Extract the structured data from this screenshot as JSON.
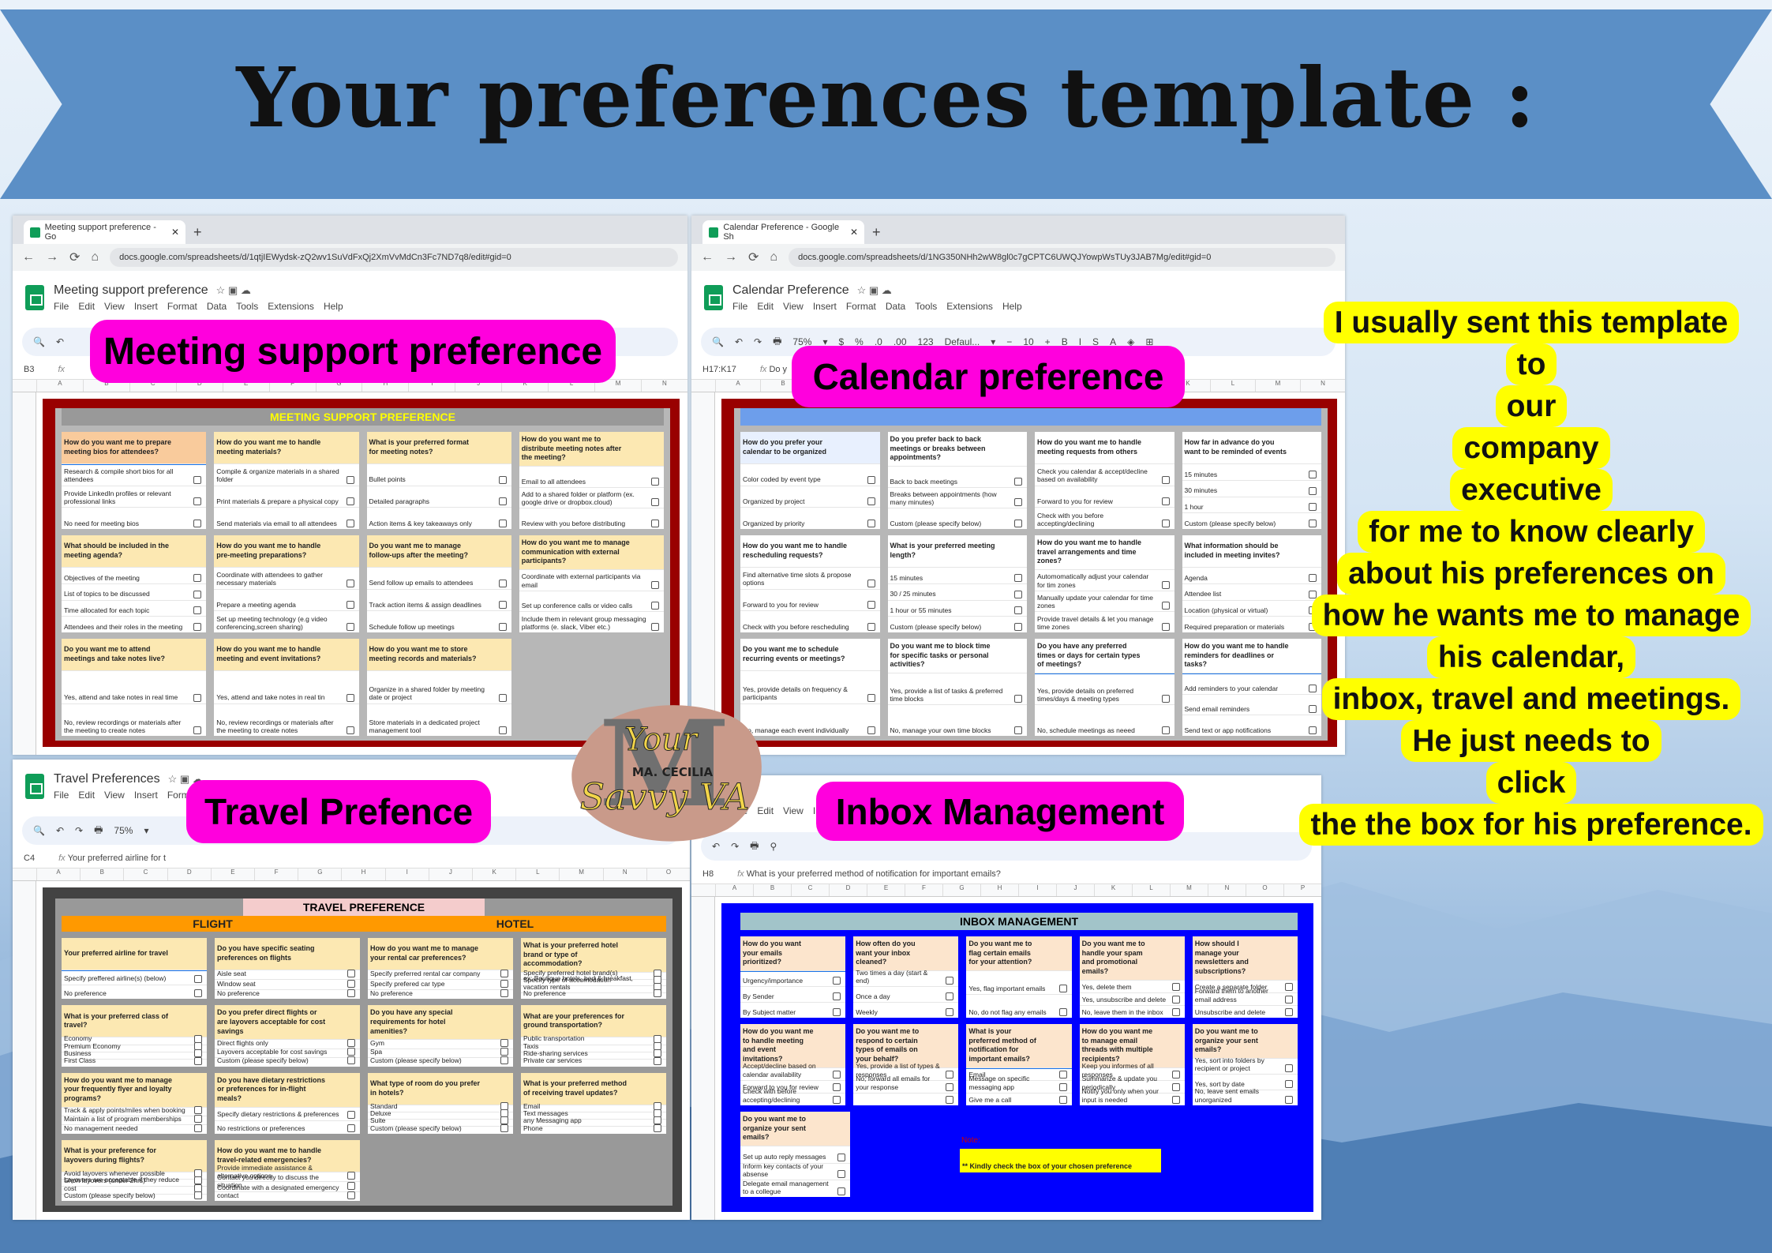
{
  "banner": {
    "title": "Your preferences template :"
  },
  "labels": {
    "meeting": "Meeting support preference",
    "calendar": "Calendar preference",
    "travel": "Travel Prefence",
    "inbox": "Inbox Management"
  },
  "logo": {
    "text_top": "Your",
    "text_mid": "MA. CECILIA",
    "text_bottom": "Savvy VA"
  },
  "message": {
    "lines": [
      "I usually sent this template",
      "to",
      "our",
      "company",
      "executive",
      "for me to know clearly",
      "about his preferences on",
      "how he wants me to manage",
      "his calendar,",
      "inbox, travel and meetings.",
      "He just needs to",
      "click",
      "the the box for his preference."
    ]
  },
  "sheets": {
    "meeting": {
      "tab": "Meeting support preference - Go",
      "url": "docs.google.com/spreadsheets/d/1qtjIEWydsk-zQ2wv1SuVdFxQj2XmVvMdCn3Fc7ND7q8/edit#gid=0",
      "doc_title": "Meeting support preference",
      "menu": [
        "File",
        "Edit",
        "View",
        "Insert",
        "Format",
        "Data",
        "Tools",
        "Extensions",
        "Help"
      ],
      "toolbar": [
        "🔍",
        "↶"
      ],
      "cell_ref": "B3",
      "formula": "",
      "columns": [
        "A",
        "B",
        "C",
        "D",
        "E",
        "F",
        "G",
        "H",
        "I",
        "J",
        "K",
        "L",
        "M",
        "N"
      ],
      "title": "MEETING SUPPORT PREFERENCE",
      "colors": {
        "frame": "#990000",
        "inner": "#b7b7b7",
        "titlebg": "#999999",
        "titlefg": "#ffff00",
        "qbg": "#fce8b2",
        "selected": "#f9cb9c"
      },
      "cols": 4,
      "bands": [
        [
          {
            "q": "How do you want me to prepare meeting bios for attendees?",
            "o": [
              "Research & compile short bios for all attendees",
              "Provide LinkedIn profiles or relevant professional links",
              "No need for meeting bios"
            ]
          },
          {
            "q": "How do you want me to handle meeting materials?",
            "o": [
              "Compile & organize materials in a shared folder",
              "Print materials & prepare a physical copy",
              "Send materials via email to all attendees"
            ]
          },
          {
            "q": "What is your preferred format for meeting notes?",
            "o": [
              "Bullet points",
              "Detailed paragraphs",
              "Action items & key takeaways only"
            ]
          },
          {
            "q": "How do you want me to distribute meeting notes after the meeting?",
            "o": [
              "Email to all attendees",
              "Add to a shared folder or platform (ex. google drive or dropbox.cloud)",
              "Review with you before distributing"
            ]
          }
        ],
        [
          {
            "q": "What should be included in the meeting agenda?",
            "o": [
              "Objectives of the meeting",
              "List of topics to be discussed",
              "Time allocated for each topic",
              "Attendees and their roles in the meeting"
            ]
          },
          {
            "q": "How do you want me to handle pre-meeting preparations?",
            "o": [
              "Coordinate with attendees to gather necessary materials",
              "Prepare a meeting agenda",
              "Set up meeting technology (e.g video conferencing,screen sharing)"
            ]
          },
          {
            "q": "Do you want me to manage follow-ups after the meeting?",
            "o": [
              "Send follow up emails to attendees",
              "Track action items & assign deadlines",
              "Schedule follow up meetings"
            ]
          },
          {
            "q": "How do you want me to manage communication with external participants?",
            "o": [
              "Coordinate with external participants via email",
              "Set up conference calls or video calls",
              "Include them in relevant group messaging platforms (e. slack, Viber etc.)"
            ]
          }
        ],
        [
          {
            "q": "Do you want me to attend meetings and take notes live?",
            "o": [
              "Yes, attend and take notes in real time",
              "No, review recordings or materials after the meeting to create notes"
            ]
          },
          {
            "q": "How do you want me to handle meeting and event invitations?",
            "o": [
              "Yes, attend and take notes in real tin",
              "No, review recordings or materials after the meeting to create notes"
            ]
          },
          {
            "q": "How do you want me to store meeting records and materials?",
            "o": [
              "Organize in a shared folder by meeting date or project",
              "Store materials in a dedicated project management tool"
            ]
          },
          null
        ]
      ]
    },
    "calendar": {
      "tab": "Calendar Preference - Google Sh",
      "url": "docs.google.com/spreadsheets/d/1NG350NHh2wW8gl0c7gCPTC6UWQJYowpWsTUy3JAB7Mg/edit#gid=0",
      "doc_title": "Calendar Preference",
      "menu": [
        "File",
        "Edit",
        "View",
        "Insert",
        "Format",
        "Data",
        "Tools",
        "Extensions",
        "Help"
      ],
      "toolbar": [
        "🔍",
        "↶",
        "↷",
        "🖶",
        "75%",
        "▾",
        "$",
        "%",
        ".0",
        ".00",
        "123",
        "Defaul...",
        "▾",
        "−",
        "10",
        "+",
        "B",
        "I",
        "S",
        "A",
        "◈",
        "⊞"
      ],
      "cell_ref": "H17:K17",
      "formula": "Do y",
      "columns": [
        "A",
        "B",
        "C",
        "D",
        "E",
        "F",
        "G",
        "H",
        "I",
        "J",
        "K",
        "L",
        "M",
        "N"
      ],
      "title": "",
      "colors": {
        "frame": "#990000",
        "inner": "#b7b7b7",
        "titlebg": "#6d9eeb",
        "titlefg": "#ffffff",
        "qbg": "#ffffff",
        "selected": "#e8f0fe"
      },
      "cols": 4,
      "bands": [
        [
          {
            "q": "How do you prefer your calendar to be organized",
            "o": [
              "Color coded by event type",
              "Organized by project",
              "Organized by priority"
            ]
          },
          {
            "q": "Do you prefer back to back meetings or breaks between appointments?",
            "o": [
              "Back to back meetings",
              "Breaks between appointments (how many minutes)",
              "Custom (please specify below)"
            ]
          },
          {
            "q": "How do you want me to handle meeting requests from others",
            "o": [
              "Check you calendar & accept/decline based on availability",
              "Forward to you for review",
              "Check with you before accepting/declining"
            ]
          },
          {
            "q": "How far in advance do you want to be reminded of events",
            "o": [
              "15 minutes",
              "30 minutes",
              "1 hour",
              "Custom (please specify below)"
            ]
          }
        ],
        [
          {
            "q": "How do you want me to handle rescheduling requests?",
            "o": [
              "Find alternative time slots & propose options",
              "Forward to you for review",
              "Check with you before rescheduling"
            ]
          },
          {
            "q": "What is your preferred meeting length?",
            "o": [
              "15 minutes",
              "30 / 25 minutes",
              "1 hour or 55 minutes",
              "Custom (please specify below)"
            ]
          },
          {
            "q": "How do you want me to handle travel arrangements and time zones?",
            "o": [
              "Automomatically adjust your calendar for tim zones",
              "Manually update your calendar for time zones",
              "Provide travel details & let you manage time zones"
            ]
          },
          {
            "q": "What information should be included in meeting invites?",
            "o": [
              "Agenda",
              "Attendee list",
              "Location (physical or virtual)",
              "Required preparation or materials"
            ]
          }
        ],
        [
          {
            "q": "Do you want me to schedule recurring events or meetings?",
            "o": [
              "Yes, provide details on frequency & participants",
              "No, manage each event individually"
            ]
          },
          {
            "q": "Do you want me to block time for specific tasks or personal activities?",
            "o": [
              "Yes, provide a list of tasks & preferred time blocks",
              "No, manage your own time blocks"
            ]
          },
          {
            "q": "Do you have any preferred times or days for certain types of meetings?",
            "o": [
              "Yes, provide details on preferred times/days & meeting types",
              "No, schedule meetings as neeed"
            ]
          },
          {
            "q": "How do you want me to handle reminders for deadlines or tasks?",
            "o": [
              "Add reminders to your calendar",
              "Send email reminders",
              "Send text or app notifications"
            ]
          }
        ]
      ]
    },
    "travel": {
      "doc_title": "Travel Preferences",
      "menu": [
        "File",
        "Edit",
        "View",
        "Insert",
        "Forma"
      ],
      "toolbar": [
        "🔍",
        "↶",
        "↷",
        "🖶",
        "75%",
        "▾"
      ],
      "cell_ref": "C4",
      "formula": "Your preferred airline for t",
      "columns": [
        "A",
        "B",
        "C",
        "D",
        "E",
        "F",
        "G",
        "H",
        "I",
        "J",
        "K",
        "L",
        "M",
        "N",
        "O"
      ],
      "title": "TRAVEL PREFERENCE",
      "sections": [
        "FLIGHT",
        "HOTEL"
      ],
      "colors": {
        "frame": "#434343",
        "inner": "#999999",
        "titlebg": "#f4cccc",
        "titlefg": "#000000",
        "qbg": "#fce8b2",
        "selected": "#fce8b2",
        "section": "#ff9900"
      },
      "cols": 4,
      "bands": [
        [
          {
            "q": "Your preferred airline for travel",
            "o": [
              "Specify preffered airline(s) (below)",
              "No preference"
            ]
          },
          {
            "q": "Do you have specific seating preferences on flights",
            "o": [
              "Aisle seat",
              "Window seat",
              "No preference"
            ]
          },
          {
            "q": "How do you want me to manage your rental car preferences?",
            "o": [
              "Specify preferred rental car company",
              "Specify prefered car type",
              "No preference"
            ]
          },
          {
            "q": "What is your preferred hotel brand or type of accommodation?",
            "o": [
              "Specify preferred hotel brand(s)",
              "Specify type of accomodation",
              "ex: Boutique hotels, bed & breakfast, vacation rentals",
              "No preference"
            ]
          }
        ],
        [
          {
            "q": "What is your preferred class of travel?",
            "o": [
              "Economy",
              "Premium Economy",
              "Business",
              "First Class"
            ]
          },
          {
            "q": "Do you prefer direct flights or are layovers acceptable for cost savings",
            "o": [
              "Direct flights only",
              "Layovers acceptable for cost savings",
              "Custom (please specify below)"
            ]
          },
          {
            "q": "Do you have any special requirements for hotel amenities?",
            "o": [
              "Gym",
              "Spa",
              "Custom (please specify below)"
            ]
          },
          {
            "q": "What are your preferences for ground transportation?",
            "o": [
              "Public transportation",
              "Taxis",
              "Ride-sharing services",
              "Private car services"
            ]
          }
        ],
        [
          {
            "q": "How do you want me to manage your frequently flyer and loyalty programs?",
            "o": [
              "Track & apply points/miles when booking",
              "Maintain a list of program memberships",
              "No management needed"
            ]
          },
          {
            "q": "Do you have dietary restrictions or preferences for in-flight meals?",
            "o": [
              "Specify dietary restrictions & preferences",
              "No restrictions or preferences"
            ]
          },
          {
            "q": "What type of room do you prefer in hotels?",
            "o": [
              "Standard",
              "Deluxe",
              "Suite",
              "Custom (please specify below)"
            ]
          },
          {
            "q": "What is your preferred method of receiving travel updates?",
            "o": [
              "Email",
              "Text messages",
              "any Messaging app",
              "Phone"
            ]
          }
        ],
        [
          {
            "q": "What is your preference for layovers during flights?",
            "o": [
              "Avoid layovers whenever possible",
              "Short layovers (under 2hrs)",
              "Layovers are acceptable if they reduce cost",
              "Custom (please specify below)"
            ]
          },
          {
            "q": "How do you want me to handle travel-related emergencies?",
            "o": [
              "Provide immediate assistance & alternative options",
              "Contact you directly to discuss the situation",
              "Coordinate with a designated emergency contact"
            ]
          },
          null,
          null
        ]
      ]
    },
    "inbox": {
      "menu": [
        "File",
        "Edit",
        "View",
        "Insert"
      ],
      "toolbar": [
        "↶",
        "↷",
        "🖶",
        "⚲"
      ],
      "cell_ref": "H8",
      "formula": "What is your preferred method of notification for important emails?",
      "columns": [
        "A",
        "B",
        "C",
        "D",
        "E",
        "F",
        "G",
        "H",
        "I",
        "J",
        "K",
        "L",
        "M",
        "N",
        "O",
        "P"
      ],
      "title": "INBOX MANAGEMENT",
      "note_label": "Note:",
      "note_text": "** Kindly check the box of your chosen preference",
      "colors": {
        "frame": "#0000ff",
        "inner": "#0000ff",
        "titlebg": "#a2c4c9",
        "titlefg": "#000000",
        "qbg": "#fce5cd",
        "selected": "#fce5cd",
        "note": "#ffff00"
      },
      "cols": 5,
      "bands": [
        [
          {
            "q": "How do you want your emails prioritized?",
            "o": [
              "Urgency/importance",
              "By Sender",
              "By Subject matter"
            ]
          },
          {
            "q": "How often do you want your inbox cleaned?",
            "o": [
              "Two times a day (start & end)",
              "Once a day",
              "Weekly"
            ]
          },
          {
            "q": "Do you want me to flag certain emails for your attention?",
            "o": [
              "Yes, flag important emails",
              "No, do not flag any emails"
            ]
          },
          {
            "q": "Do you want me to handle your spam and promotional emails?",
            "o": [
              "Yes, delete them",
              "Yes, unsubscribe and delete",
              "No, leave them in the inbox"
            ]
          },
          {
            "q": "How should I manage your newsletters and subscriptions?",
            "o": [
              "Create a separate folder",
              "Forward them to another email address",
              "Unsubscribe and delete"
            ]
          }
        ],
        [
          {
            "q": "How do you want me to handle meeting and event invitations?",
            "o": [
              "Accept/decline based on calendar availability",
              "Forward to you for review",
              "Check with before accepting/declining"
            ]
          },
          {
            "q": "Do you want me to respond to certain types of emails on your behalf?",
            "o": [
              "Yes, provide a list of types & responses",
              "No, forward all emails for your response",
              ""
            ]
          },
          {
            "q": "What is your preferred method of notification for important emails?",
            "o": [
              "Email",
              "Message on specific messaging app",
              "Give me a call"
            ]
          },
          {
            "q": "How do you want me to manage email threads with multiple recipients?",
            "o": [
              "Keep you informes of all responses",
              "Summarize & update you periodically",
              "Notify you only when your input is needed"
            ]
          },
          {
            "q": "Do you want me to organize your sent emails?",
            "o": [
              "Yes, sort into folders by recipient or project",
              "Yes, sort by date",
              "No, leave sent emails unorganized"
            ]
          }
        ],
        [
          {
            "q": "Do you want me to organize your sent emails?",
            "o": [
              "Set up auto reply messages",
              "Inform key contacts of your absense",
              "Delegate email management to a collegue"
            ]
          },
          null,
          null,
          null,
          null
        ]
      ]
    }
  }
}
